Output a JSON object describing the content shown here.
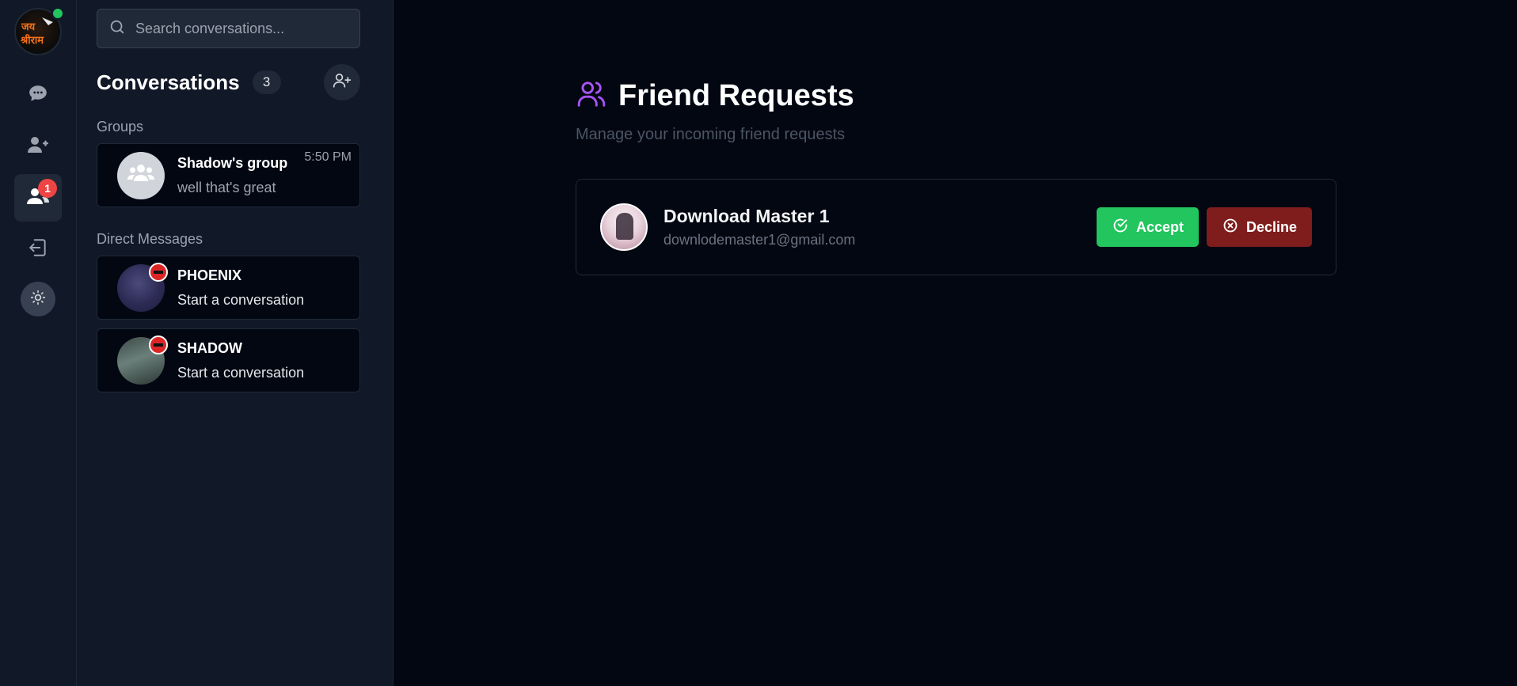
{
  "rail": {
    "logo_text": "जय श्रीराम",
    "friends_badge": "1"
  },
  "sidebar": {
    "search_placeholder": "Search conversations...",
    "title": "Conversations",
    "count": "3",
    "groups_label": "Groups",
    "dm_label": "Direct Messages",
    "groups": [
      {
        "name": "Shadow's group",
        "preview": "well that's great",
        "time": "5:50 PM"
      }
    ],
    "direct_messages": [
      {
        "name": "PHOENIX",
        "preview": "Start a conversation"
      },
      {
        "name": "SHADOW",
        "preview": "Start a conversation"
      }
    ]
  },
  "main": {
    "title": "Friend Requests",
    "subtitle": "Manage your incoming friend requests",
    "requests": [
      {
        "name": "Download Master 1",
        "email": "downlodemaster1@gmail.com",
        "accept_label": "Accept",
        "decline_label": "Decline"
      }
    ]
  },
  "colors": {
    "accent_purple": "#a855f7",
    "accept_green": "#22c55e",
    "decline_red": "#7f1d1d",
    "badge_red": "#ef4444",
    "online_green": "#22c55e"
  }
}
